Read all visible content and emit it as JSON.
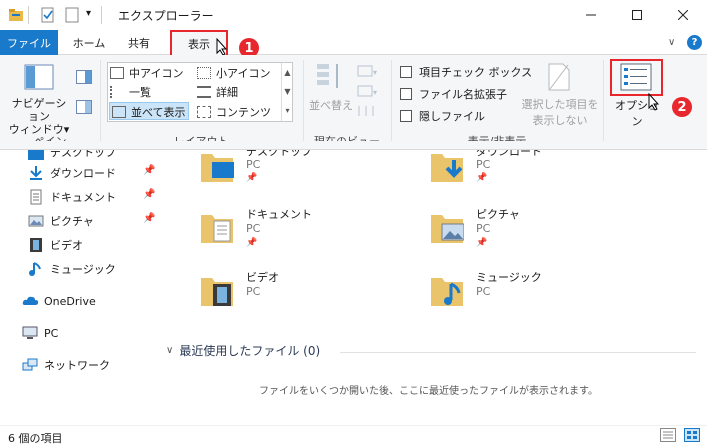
{
  "window": {
    "title": "エクスプローラー",
    "controls": [
      "minimize-icon",
      "maximize-icon",
      "close-icon"
    ]
  },
  "ribbon_tabs": {
    "file": "ファイル",
    "home": "ホーム",
    "share": "共有",
    "view": "表示"
  },
  "ribbon": {
    "pane": {
      "nav_pane_line1": "ナビゲーション",
      "nav_pane_line2": "ウィンドウ▾",
      "label": "ペイン"
    },
    "layout": {
      "items": [
        "中アイコン",
        "小アイコン",
        "一覧",
        "詳細",
        "並べて表示",
        "コンテンツ"
      ],
      "label": "レイアウト"
    },
    "current_view": {
      "sort_label": "並べ替え",
      "label": "現在のビュー"
    },
    "show_hide": {
      "item_checkbox": "項目チェック ボックス",
      "file_ext": "ファイル名拡張子",
      "hidden": "隠しファイル",
      "hide_selected_line1": "選択した項目を",
      "hide_selected_line2": "表示しない",
      "label": "表示/非表示"
    },
    "options_label": "オプション"
  },
  "annotations": {
    "step1": "1",
    "step2": "2"
  },
  "nav": {
    "items": [
      "デスクトップ",
      "ダウンロード",
      "ドキュメント",
      "ピクチャ",
      "ビデオ",
      "ミュージック",
      "OneDrive",
      "PC",
      "ネットワーク"
    ]
  },
  "folders": [
    {
      "name": "デスクトップ",
      "sub": "PC"
    },
    {
      "name": "ダウンロード",
      "sub": "PC"
    },
    {
      "name": "ドキュメント",
      "sub": "PC"
    },
    {
      "name": "ピクチャ",
      "sub": "PC"
    },
    {
      "name": "ビデオ",
      "sub": "PC"
    },
    {
      "name": "ミュージック",
      "sub": "PC"
    }
  ],
  "recent": {
    "header": "最近使用したファイル (0)",
    "empty_message": "ファイルをいくつか開いた後、ここに最近使ったファイルが表示されます。"
  },
  "status": {
    "count": "6 個の項目"
  },
  "colors": {
    "accent": "#1979ca",
    "highlight": "#e8262e",
    "folder": "#e9c46a"
  }
}
